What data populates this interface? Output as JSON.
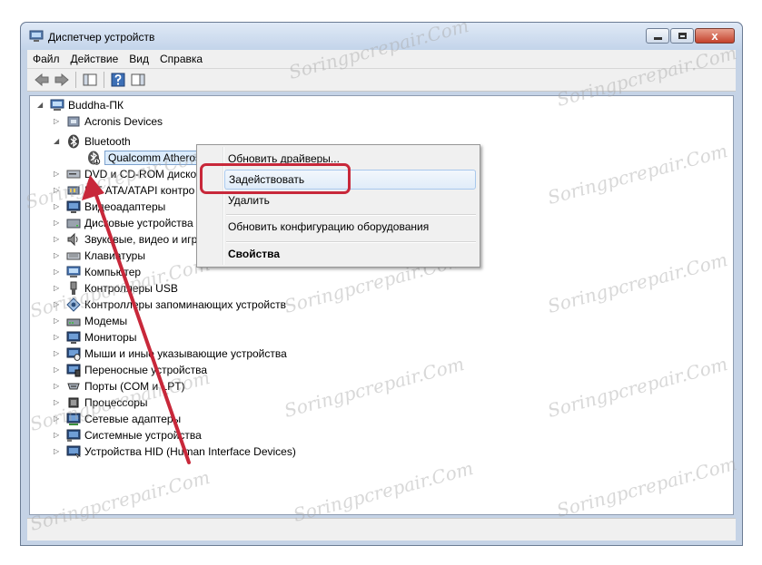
{
  "window": {
    "title": "Диспетчер устройств",
    "close_glyph": "x"
  },
  "menubar": {
    "items": [
      {
        "label": "Файл"
      },
      {
        "label": "Действие"
      },
      {
        "label": "Вид"
      },
      {
        "label": "Справка"
      }
    ]
  },
  "toolbar": {
    "buttons": [
      "back-arrow-icon",
      "forward-arrow-icon",
      "console-tree-icon",
      "help-icon",
      "properties-pane-icon"
    ]
  },
  "tree": {
    "root": "Buddha-ПК",
    "items": [
      {
        "label": "Acronis Devices",
        "icon": "device-box-icon"
      },
      {
        "label": "Bluetooth",
        "icon": "bluetooth-icon",
        "expanded": true
      },
      {
        "label": "Qualcomm Atheros",
        "icon": "bluetooth-disabled-icon",
        "child": true,
        "selected": true
      },
      {
        "label": "DVD и CD-ROM дисков",
        "icon": "dvd-icon"
      },
      {
        "label": "IDE ATA/ATAPI контро",
        "icon": "ide-icon"
      },
      {
        "label": "Видеоадаптеры",
        "icon": "monitor-icon"
      },
      {
        "label": "Дисковые устройства",
        "icon": "disk-icon"
      },
      {
        "label": "Звуковые, видео и игр",
        "icon": "speaker-icon"
      },
      {
        "label": "Клавиатуры",
        "icon": "keyboard-icon"
      },
      {
        "label": "Компьютер",
        "icon": "computer-icon"
      },
      {
        "label": "Контроллеры USB",
        "icon": "usb-icon"
      },
      {
        "label": "Контроллеры запоминающих устройств",
        "icon": "storage-controller-icon"
      },
      {
        "label": "Модемы",
        "icon": "modem-icon"
      },
      {
        "label": "Мониторы",
        "icon": "monitor-icon"
      },
      {
        "label": "Мыши и иные указывающие устройства",
        "icon": "mouse-icon"
      },
      {
        "label": "Переносные устройства",
        "icon": "portable-device-icon"
      },
      {
        "label": "Порты (COM и LPT)",
        "icon": "port-icon"
      },
      {
        "label": "Процессоры",
        "icon": "cpu-icon"
      },
      {
        "label": "Сетевые адаптеры",
        "icon": "network-adapter-icon"
      },
      {
        "label": "Системные устройства",
        "icon": "system-device-icon"
      },
      {
        "label": "Устройства HID (Human Interface Devices)",
        "icon": "hid-icon"
      }
    ]
  },
  "context_menu": {
    "items": [
      {
        "label": "Обновить драйверы..."
      },
      {
        "label": "Задействовать",
        "highlighted": true
      },
      {
        "label": "Удалить"
      },
      {
        "label": "Обновить конфигурацию оборудования"
      },
      {
        "label": "Свойства",
        "bold": true
      }
    ]
  },
  "watermark": "Soringpcrepair.Com",
  "colors": {
    "annotation_red": "#c8283a",
    "selection_blue": "#dcecfc"
  }
}
